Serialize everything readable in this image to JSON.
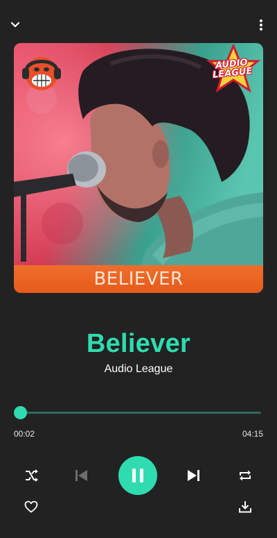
{
  "header": {
    "collapse_icon": "chevron-down-icon",
    "menu_icon": "more-vertical-icon"
  },
  "album_art": {
    "caption": "BELIEVER",
    "badge_text": "AUDIO LEAGUE"
  },
  "track": {
    "title": "Believer",
    "artist": "Audio League"
  },
  "progress": {
    "elapsed": "00:02",
    "duration": "04:15",
    "fraction": 0.008
  },
  "controls": {
    "shuffle_icon": "shuffle-icon",
    "previous_icon": "skip-previous-icon",
    "play_pause_icon": "pause-icon",
    "next_icon": "skip-next-icon",
    "repeat_icon": "repeat-icon",
    "favorite_icon": "heart-outline-icon",
    "download_icon": "download-icon"
  },
  "colors": {
    "accent": "#2fdcb0",
    "background": "#222222",
    "caption_band": "#e65b1b"
  }
}
